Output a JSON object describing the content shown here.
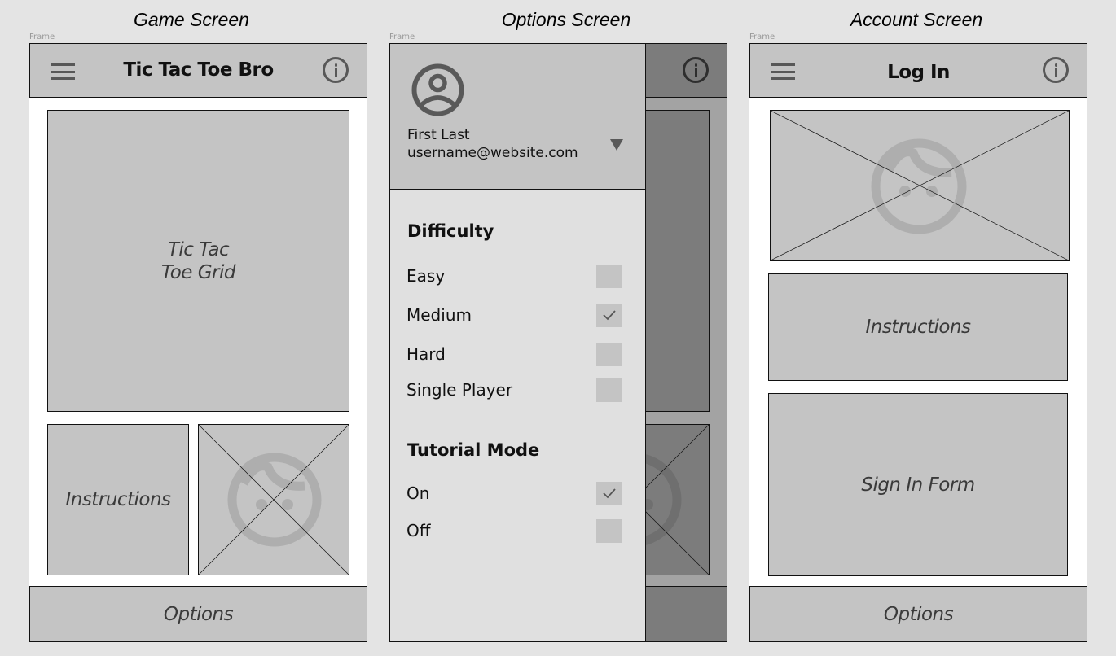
{
  "screens": {
    "game": {
      "title": "Game Screen",
      "frame_label": "Frame",
      "appbar_title": "Tic Tac Toe Bro",
      "grid_label": "Tic Tac\nToe Grid",
      "instructions_label": "Instructions",
      "image_placeholder_icon": "face-icon",
      "bottom_button": "Options"
    },
    "options": {
      "title": "Options Screen",
      "frame_label": "Frame",
      "user": {
        "name": "First Last",
        "email": "username@website.com"
      },
      "sections": [
        {
          "heading": "Difficulty",
          "options": [
            {
              "label": "Easy",
              "checked": false
            },
            {
              "label": "Medium",
              "checked": true
            },
            {
              "label": "Hard",
              "checked": false
            },
            {
              "label": "Single Player",
              "checked": false
            }
          ]
        },
        {
          "heading": "Tutorial Mode",
          "options": [
            {
              "label": "On",
              "checked": true
            },
            {
              "label": "Off",
              "checked": false
            }
          ]
        }
      ]
    },
    "account": {
      "title": "Account Screen",
      "frame_label": "Frame",
      "appbar_title": "Log In",
      "instructions_label": "Instructions",
      "form_label": "Sign In Form",
      "bottom_button": "Options"
    }
  },
  "colors": {
    "background": "#e4e4e4",
    "placeholder_fill": "#c4c4c4",
    "drawer_fill": "#e0e0e0",
    "scrim_fill": "#7c7c7c",
    "icon_gray": "#585858"
  }
}
